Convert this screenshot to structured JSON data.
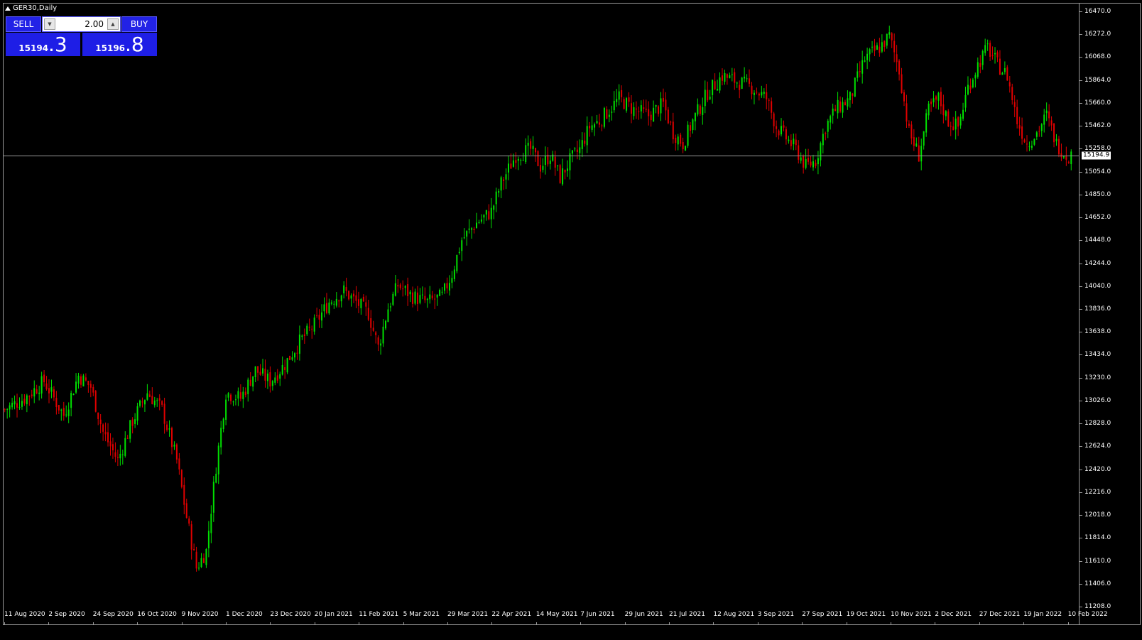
{
  "window": {
    "title": "GER30,Daily"
  },
  "trade_panel": {
    "sell_label": "SELL",
    "buy_label": "BUY",
    "lot_value": "2.00",
    "sell_price_main": "15194",
    "sell_price_big": ".3",
    "buy_price_main": "15196",
    "buy_price_big": ".8"
  },
  "colors": {
    "bull": "#00e000",
    "bear": "#e00000",
    "background": "#000000",
    "grid_line": "#9a9a9a"
  },
  "current_price_label": "15194.9",
  "chart_data": {
    "type": "candlestick",
    "symbol": "GER30",
    "timeframe": "Daily",
    "current_price": 15194.9,
    "ylim": [
      11208,
      16470
    ],
    "y_ticks": [
      "16470.0",
      "16272.0",
      "16068.0",
      "15864.0",
      "15660.0",
      "15462.0",
      "15258.0",
      "15054.0",
      "14850.0",
      "14652.0",
      "14448.0",
      "14244.0",
      "14040.0",
      "13836.0",
      "13638.0",
      "13434.0",
      "13230.0",
      "13026.0",
      "12828.0",
      "12624.0",
      "12420.0",
      "12216.0",
      "12018.0",
      "11814.0",
      "11610.0",
      "11406.0",
      "11208.0"
    ],
    "x_ticks": [
      "11 Aug 2020",
      "2 Sep 2020",
      "24 Sep 2020",
      "16 Oct 2020",
      "9 Nov 2020",
      "1 Dec 2020",
      "23 Dec 2020",
      "20 Jan 2021",
      "11 Feb 2021",
      "5 Mar 2021",
      "29 Mar 2021",
      "22 Apr 2021",
      "14 May 2021",
      "7 Jun 2021",
      "29 Jun 2021",
      "21 Jul 2021",
      "12 Aug 2021",
      "3 Sep 2021",
      "27 Sep 2021",
      "19 Oct 2021",
      "10 Nov 2021",
      "2 Dec 2021",
      "27 Dec 2021",
      "19 Jan 2022",
      "10 Feb 2022"
    ],
    "close_path": [
      [
        0,
        12950
      ],
      [
        8,
        13050
      ],
      [
        16,
        13200
      ],
      [
        24,
        12900
      ],
      [
        30,
        13250
      ],
      [
        35,
        13150
      ],
      [
        40,
        12750
      ],
      [
        46,
        12500
      ],
      [
        52,
        12850
      ],
      [
        58,
        13100
      ],
      [
        64,
        12950
      ],
      [
        70,
        12500
      ],
      [
        74,
        12000
      ],
      [
        78,
        11550
      ],
      [
        82,
        11700
      ],
      [
        86,
        12450
      ],
      [
        90,
        13100
      ],
      [
        96,
        13050
      ],
      [
        102,
        13300
      ],
      [
        108,
        13200
      ],
      [
        114,
        13350
      ],
      [
        120,
        13550
      ],
      [
        126,
        13700
      ],
      [
        132,
        13900
      ],
      [
        138,
        14000
      ],
      [
        143,
        13900
      ],
      [
        148,
        13800
      ],
      [
        152,
        13500
      ],
      [
        156,
        13850
      ],
      [
        160,
        14050
      ],
      [
        166,
        13950
      ],
      [
        172,
        13900
      ],
      [
        178,
        13950
      ],
      [
        182,
        14150
      ],
      [
        186,
        14450
      ],
      [
        192,
        14600
      ],
      [
        198,
        14700
      ],
      [
        202,
        14950
      ],
      [
        208,
        15200
      ],
      [
        214,
        15250
      ],
      [
        218,
        15100
      ],
      [
        222,
        15200
      ],
      [
        226,
        15000
      ],
      [
        230,
        15150
      ],
      [
        234,
        15250
      ],
      [
        238,
        15450
      ],
      [
        242,
        15500
      ],
      [
        246,
        15600
      ],
      [
        250,
        15700
      ],
      [
        256,
        15600
      ],
      [
        262,
        15550
      ],
      [
        268,
        15650
      ],
      [
        272,
        15400
      ],
      [
        276,
        15300
      ],
      [
        280,
        15500
      ],
      [
        286,
        15750
      ],
      [
        292,
        15900
      ],
      [
        298,
        15850
      ],
      [
        304,
        15800
      ],
      [
        310,
        15700
      ],
      [
        314,
        15450
      ],
      [
        318,
        15350
      ],
      [
        322,
        15250
      ],
      [
        326,
        15100
      ],
      [
        330,
        15150
      ],
      [
        334,
        15450
      ],
      [
        338,
        15600
      ],
      [
        344,
        15700
      ],
      [
        350,
        16050
      ],
      [
        356,
        16150
      ],
      [
        360,
        16250
      ],
      [
        364,
        15950
      ],
      [
        368,
        15400
      ],
      [
        372,
        15200
      ],
      [
        376,
        15600
      ],
      [
        380,
        15700
      ],
      [
        384,
        15500
      ],
      [
        388,
        15450
      ],
      [
        392,
        15800
      ],
      [
        396,
        16000
      ],
      [
        400,
        16150
      ],
      [
        404,
        16000
      ],
      [
        408,
        15900
      ],
      [
        412,
        15500
      ],
      [
        416,
        15300
      ],
      [
        420,
        15400
      ],
      [
        424,
        15550
      ],
      [
        428,
        15300
      ],
      [
        432,
        15200
      ],
      [
        434,
        15195
      ]
    ]
  }
}
